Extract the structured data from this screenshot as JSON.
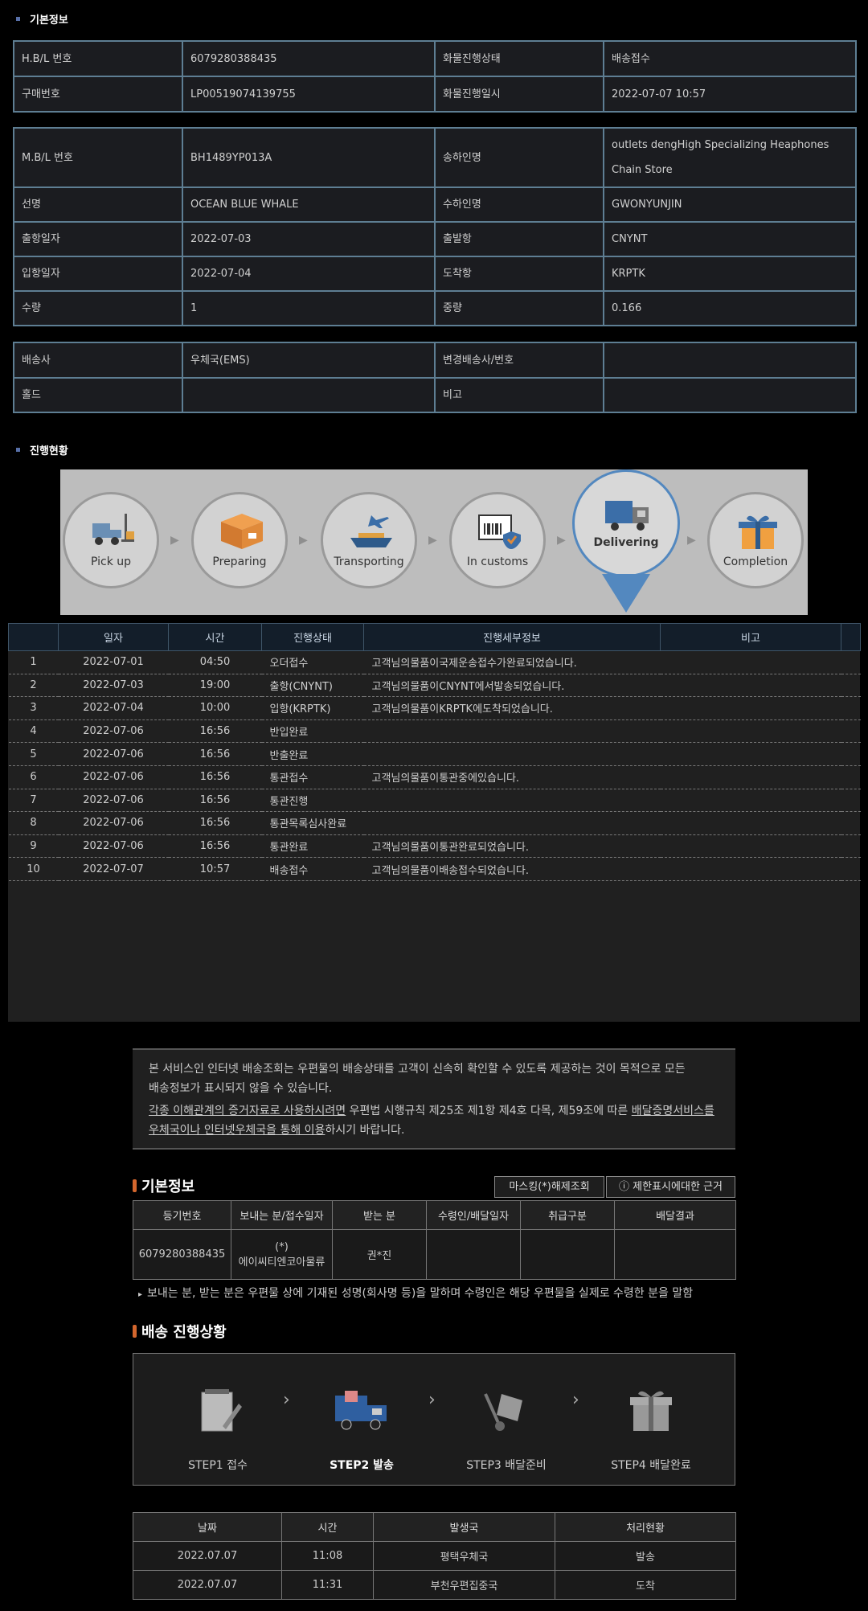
{
  "sections": {
    "basic": "기본정보",
    "progress": "진행현황"
  },
  "info1": [
    [
      "H.B/L 번호",
      "6079280388435",
      "화물진행상태",
      "배송접수"
    ],
    [
      "구매번호",
      "LP00519074139755",
      "화물진행일시",
      "2022-07-07 10:57"
    ]
  ],
  "info2": [
    [
      "M.B/L 번호",
      "BH1489YP013A",
      "송하인명",
      "outlets dengHigh Specializing Heaphones Chain Store"
    ],
    [
      "선명",
      "OCEAN BLUE WHALE",
      "수하인명",
      "GWONYUNJIN"
    ],
    [
      "출항일자",
      "2022-07-03",
      "출발항",
      "CNYNT"
    ],
    [
      "입항일자",
      "2022-07-04",
      "도착항",
      "KRPTK"
    ],
    [
      "수량",
      "1",
      "중량",
      "0.166"
    ]
  ],
  "info3": [
    [
      "배송사",
      "우체국(EMS)",
      "변경배송사/번호",
      ""
    ],
    [
      "홀드",
      "",
      "비고",
      ""
    ]
  ],
  "steps": [
    "Pick up",
    "Preparing",
    "Transporting",
    "In customs",
    "Delivering",
    "Completion"
  ],
  "track_headers": [
    "",
    "일자",
    "시간",
    "진행상태",
    "진행세부정보",
    "비고"
  ],
  "track_rows": [
    [
      "1",
      "2022-07-01",
      "04:50",
      "오더접수",
      "고객님의물품이국제운송접수가완료되었습니다."
    ],
    [
      "2",
      "2022-07-03",
      "19:00",
      "출항(CNYNT)",
      "고객님의물품이CNYNT에서발송되었습니다."
    ],
    [
      "3",
      "2022-07-04",
      "10:00",
      "입항(KRPTK)",
      "고객님의물품이KRPTK에도착되었습니다."
    ],
    [
      "4",
      "2022-07-06",
      "16:56",
      "반입완료",
      ""
    ],
    [
      "5",
      "2022-07-06",
      "16:56",
      "반출완료",
      ""
    ],
    [
      "6",
      "2022-07-06",
      "16:56",
      "통관접수",
      "고객님의물품이통관중에있습니다."
    ],
    [
      "7",
      "2022-07-06",
      "16:56",
      "통관진행",
      ""
    ],
    [
      "8",
      "2022-07-06",
      "16:56",
      "통관목록심사완료",
      ""
    ],
    [
      "9",
      "2022-07-06",
      "16:56",
      "통관완료",
      "고객님의물품이통관완료되었습니다."
    ],
    [
      "10",
      "2022-07-07",
      "10:57",
      "배송접수",
      "고객님의물품이배송접수되었습니다."
    ]
  ],
  "notice": {
    "line1": "본 서비스인 인터넷 배송조회는 우편물의 배송상태를 고객이 신속히 확인할 수 있도록 제공하는 것이 목적으로 모든",
    "line2": "배송정보가 표시되지 않을 수 있습니다.",
    "u1": "각종 이해관계의 증거자료로 사용하시려면",
    "t1": " 우편법 시행규칙 제25조 제1항 제4호 다목, 제59조에 따른 ",
    "u2": "배달증명서비스를",
    "u3": "우체국이나 인터넷우체국을 통해 이용",
    "t2": "하시기 바랍니다."
  },
  "post": {
    "title": "기본정보",
    "btn_unmask": "마스킹(*)해제조회",
    "btn_reason": "ⓘ 제한표시에대한 근거",
    "headers": [
      "등기번호",
      "보내는 분/접수일자",
      "받는 분",
      "수령인/배달일자",
      "취급구분",
      "배달결과"
    ],
    "row": {
      "reg": "6079280388435",
      "sender_mark": "(*)",
      "sender": "에이씨티엔코아물류",
      "receiver": "권*진"
    },
    "note": "보내는 분, 받는 분은 우편물 상에 기재된 성명(회사명 등)을 말하며 수령인은 해당 우편물을 실제로 수령한 분을 말함"
  },
  "delivery": {
    "title": "배송 진행상황",
    "steps": [
      "STEP1 접수",
      "STEP2 발송",
      "STEP3 배달준비",
      "STEP4 배달완료"
    ],
    "headers": [
      "날짜",
      "시간",
      "발생국",
      "처리현황"
    ],
    "rows": [
      [
        "2022.07.07",
        "11:08",
        "평택우체국",
        "발송"
      ],
      [
        "2022.07.07",
        "11:31",
        "부천우편집중국",
        "도착"
      ]
    ]
  }
}
